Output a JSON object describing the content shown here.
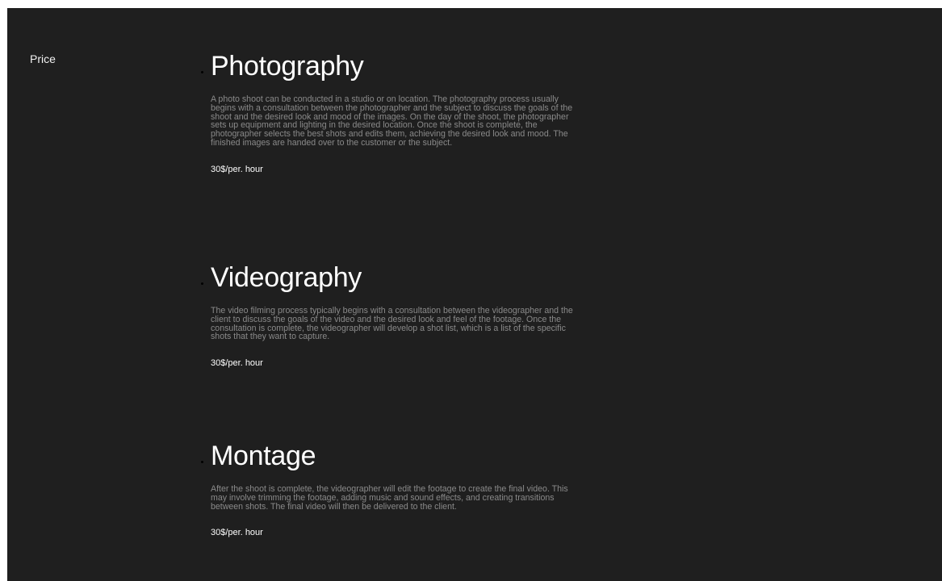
{
  "sidebar": {
    "label": "Price"
  },
  "services": [
    {
      "title": "Photography",
      "description": "A photo shoot can be conducted in a studio or on location. The photography process usually begins with a consultation between the photographer and the subject to discuss the goals of the shoot and the desired look and mood of the images. On the day of the shoot, the photographer sets up equipment and lighting in the desired location. Once the shoot is complete, the photographer selects the best shots and edits them, achieving the desired look and mood. The finished images are handed over to the customer or the subject.",
      "price": "30$/per. hour"
    },
    {
      "title": "Videography",
      "description": "The video filming process typically begins with a consultation between the videographer and the client to discuss the goals of the video and the desired look and feel of the footage. Once the consultation is complete, the videographer will develop a shot list, which is a list of the specific shots that they want to capture.",
      "price": "30$/per. hour"
    },
    {
      "title": "Montage",
      "description": "After the shoot is complete, the videographer will edit the footage to create the final video. This may involve trimming the footage, adding music and sound effects, and creating transitions between shots. The final video will then be delivered to the client.",
      "price": "30$/per. hour"
    }
  ],
  "colors": {
    "background": "#1f1f1f",
    "title": "#ffffff",
    "body_text": "#8a8a8a"
  }
}
